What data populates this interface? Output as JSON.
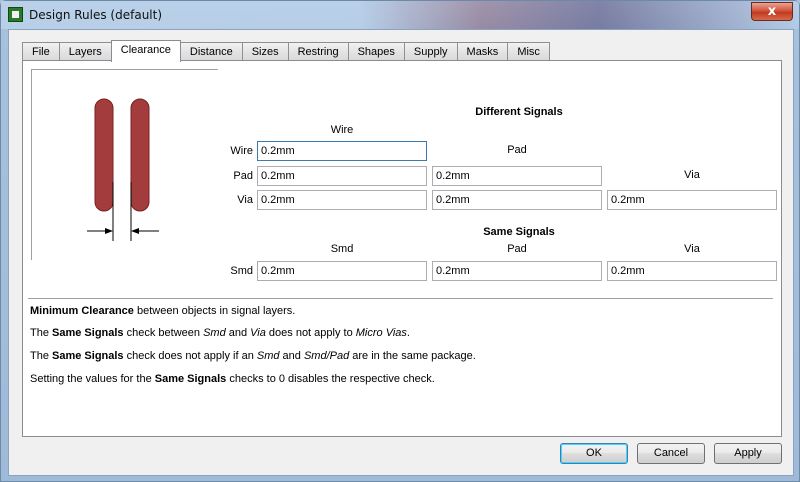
{
  "window": {
    "title": "Design Rules (default)",
    "close_label": "x"
  },
  "tabs": [
    {
      "label": "File",
      "active": false
    },
    {
      "label": "Layers",
      "active": false
    },
    {
      "label": "Clearance",
      "active": true
    },
    {
      "label": "Distance",
      "active": false
    },
    {
      "label": "Sizes",
      "active": false
    },
    {
      "label": "Restring",
      "active": false
    },
    {
      "label": "Shapes",
      "active": false
    },
    {
      "label": "Supply",
      "active": false
    },
    {
      "label": "Masks",
      "active": false
    },
    {
      "label": "Misc",
      "active": false
    }
  ],
  "different_signals": {
    "title": "Different Signals",
    "col_wire": "Wire",
    "col_pad": "Pad",
    "col_via": "Via",
    "row_wire": "Wire",
    "row_pad": "Pad",
    "row_via": "Via",
    "wire_wire": "0.2mm",
    "pad_wire": "0.2mm",
    "pad_pad": "0.2mm",
    "via_wire": "0.2mm",
    "via_pad": "0.2mm",
    "via_via": "0.2mm"
  },
  "same_signals": {
    "title": "Same Signals",
    "col_smd": "Smd",
    "col_pad": "Pad",
    "col_via": "Via",
    "row_smd": "Smd",
    "smd_smd": "0.2mm",
    "smd_pad": "0.2mm",
    "smd_via": "0.2mm"
  },
  "description": {
    "line1_bold": "Minimum Clearance",
    "line1_rest": " between objects in signal layers.",
    "line2_a": "The ",
    "line2_bold": "Same Signals",
    "line2_b": " check between ",
    "line2_i1": "Smd",
    "line2_c": " and ",
    "line2_i2": "Via",
    "line2_d": " does not apply to ",
    "line2_i3": "Micro Vias",
    "line2_e": ".",
    "line3_a": "The ",
    "line3_bold": "Same Signals",
    "line3_b": " check does not apply if an ",
    "line3_i1": "Smd",
    "line3_c": " and ",
    "line3_i2": "Smd/Pad",
    "line3_d": " are in the same package.",
    "line4_a": "Setting the values for the ",
    "line4_bold": "Same Signals",
    "line4_b": " checks to 0 disables the respective check."
  },
  "buttons": {
    "ok": "OK",
    "cancel": "Cancel",
    "apply": "Apply"
  },
  "colors": {
    "trace": "#a33d3d",
    "trace_border": "#7a2020"
  }
}
